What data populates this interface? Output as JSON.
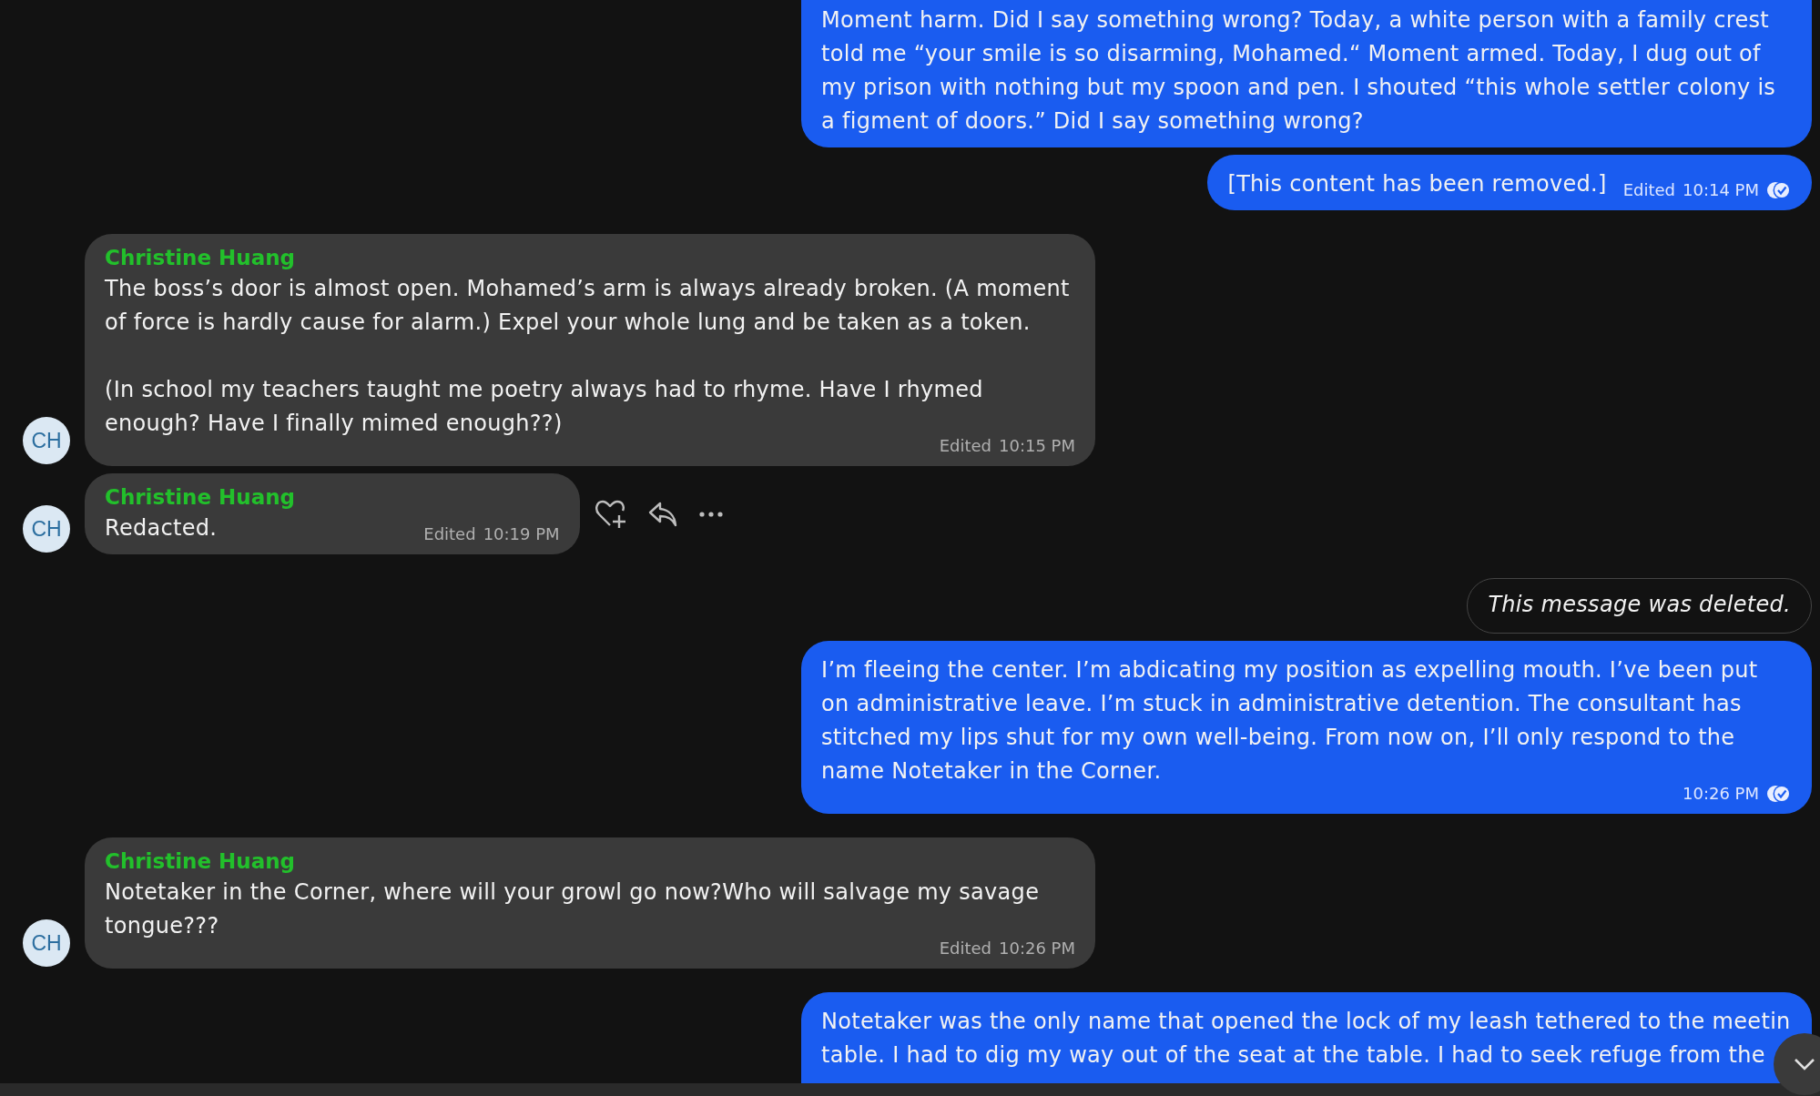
{
  "messages": [
    {
      "kind": "outgoing",
      "paragraphs": [
        "Moment harm. Did I say something wrong? Today, a white person with a family crest told me “your smile is so disarming, Mohamed.“ Moment armed. Today, I dug out of my prison with nothing but my spoon and pen. I shouted “this whole settler colony is a figment of doors.” Did I say something wrong?"
      ]
    },
    {
      "kind": "outgoing",
      "paragraphs": [
        "[This content has been removed.]"
      ],
      "edited_label": "Edited",
      "time": "10:14 PM",
      "read": true
    },
    {
      "kind": "incoming",
      "avatar": "CH",
      "sender": "Christine Huang",
      "paragraphs": [
        "The boss’s door is almost open. Mohamed’s arm is always already broken. (A moment of force is hardly cause for alarm.) Expel your whole lung and be taken as a token.",
        "(In school my teachers taught me poetry always had to rhyme. Have I rhymed enough? Have I finally mimed enough??)"
      ],
      "edited_label": "Edited",
      "time": "10:15 PM"
    },
    {
      "kind": "incoming",
      "avatar": "CH",
      "sender": "Christine Huang",
      "paragraphs": [
        "Redacted."
      ],
      "edited_label": "Edited",
      "time": "10:19 PM",
      "show_actions": true
    },
    {
      "kind": "deleted",
      "paragraphs": [
        "This message was deleted."
      ]
    },
    {
      "kind": "outgoing",
      "paragraphs": [
        "I’m fleeing the center. I’m abdicating my position as expelling mouth. I’ve been put on administrative leave. I’m stuck in administrative detention. The consultant has stitched my lips shut for my own well-being. From now on, I’ll only respond to the name Notetaker in the Corner."
      ],
      "time": "10:26 PM",
      "read": true
    },
    {
      "kind": "incoming",
      "avatar": "CH",
      "sender": "Christine Huang",
      "paragraphs": [
        "Notetaker in the Corner, where will your growl go now?Who will salvage my savage tongue???"
      ],
      "edited_label": "Edited",
      "time": "10:26 PM"
    },
    {
      "kind": "outgoing",
      "paragraphs": [
        "Notetaker was the only name that opened the lock of my leash tethered to the meetin table. I had to dig my way out of the seat at the table. I had to seek refuge from the"
      ]
    }
  ]
}
